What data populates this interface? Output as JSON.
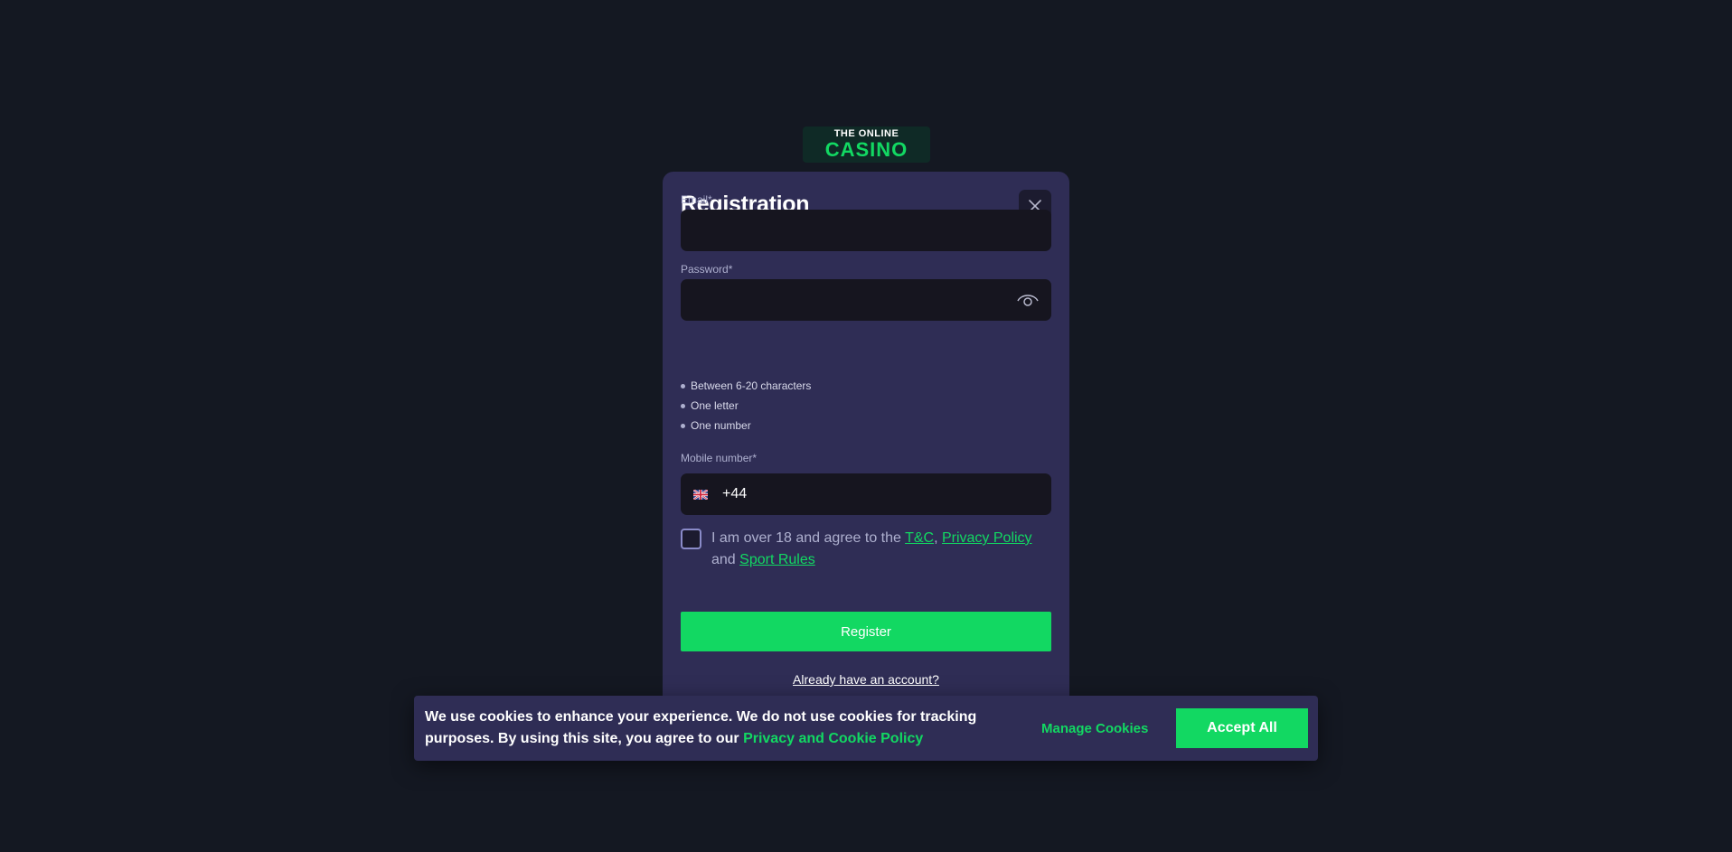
{
  "logo": {
    "line1": "THE ONLINE",
    "line2": "CASINO"
  },
  "modal": {
    "title": "Registration",
    "close_icon": "close-icon",
    "email": {
      "label": "Email*",
      "value": ""
    },
    "password": {
      "label": "Password*",
      "value": "",
      "toggle_icon": "eye-icon",
      "rules": [
        "Between 6-20 characters",
        "One letter",
        "One number"
      ]
    },
    "mobile": {
      "label": "Mobile number*",
      "flag_icon": "uk-flag-icon",
      "prefix": "+44",
      "value": ""
    },
    "agree": {
      "checked": false,
      "text_before": "I am over 18 and agree to the ",
      "tc": "T&C",
      "comma": ", ",
      "privacy": "Privacy Policy",
      "and": " and ",
      "sport": "Sport Rules"
    },
    "register_label": "Register",
    "login_link": "Already have an account?"
  },
  "cookie": {
    "text": "We use cookies to enhance your experience. We do not use cookies for tracking purposes. By using this site, you agree to our ",
    "policy_link": "Privacy and Cookie Policy",
    "manage_label": "Manage Cookies",
    "accept_label": "Accept All"
  },
  "colors": {
    "background": "#141822",
    "modal": "#2f2d55",
    "input": "#16151f",
    "accent": "#12d862"
  }
}
